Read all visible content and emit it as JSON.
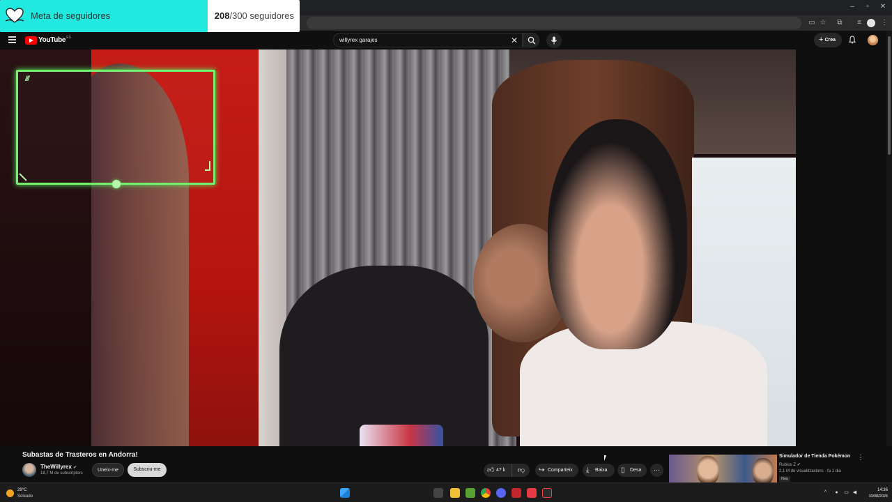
{
  "goal_widget": {
    "label": "Meta de seguidores",
    "current": "208",
    "separator_total": "/300 seguidores",
    "progress": 0.6933
  },
  "header": {
    "logo_text": "YouTube",
    "logo_region": "ES",
    "search_query": "willyrex garajes",
    "create_label": "Crea"
  },
  "video": {
    "title": "Subastas de Trasteros en Andorra!",
    "channel_name": "TheWillyrex",
    "channel_subs": "18,7 M de subscriptors",
    "join_label": "Uneix-me",
    "subscribe_label": "Subscriu-me",
    "likes": "47 k",
    "share_label": "Comparteix",
    "download_label": "Baixa",
    "save_label": "Desa",
    "more_label": "···"
  },
  "recommendation": {
    "title": "Simulador de Tienda Pokémon",
    "channel": "Rubius Z",
    "meta": "2,1 M de visualitzacions · fa 1 dia",
    "badge": "Nou"
  },
  "taskbar": {
    "weather_temp": "29°C",
    "weather_desc": "Soleado",
    "time": "14:36",
    "date": "10/08/2026"
  },
  "colors": {
    "goal_fill": "#22e9e0",
    "webcam_border": "#74f06f",
    "youtube_red": "#ff0000"
  }
}
